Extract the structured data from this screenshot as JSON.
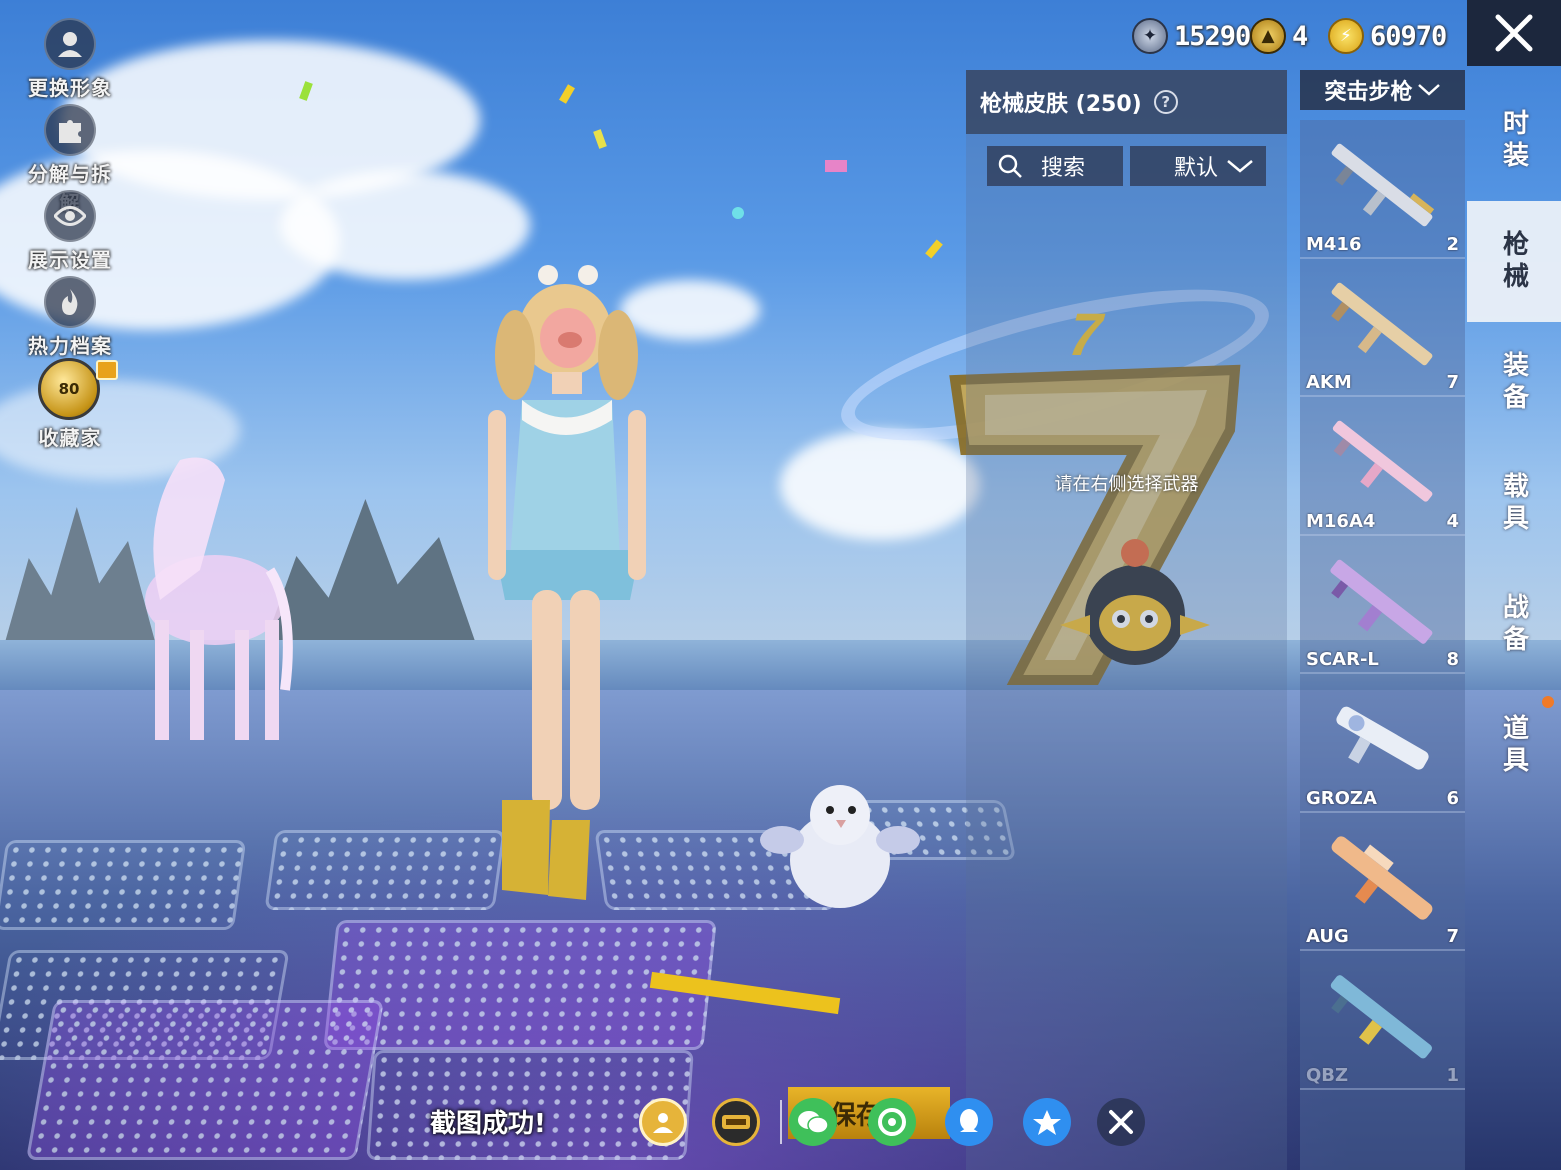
{
  "left_menu": [
    {
      "label": "更换形象",
      "icon": "avatar-icon"
    },
    {
      "label": "分解与拆解",
      "icon": "puzzle-icon"
    },
    {
      "label": "展示设置",
      "icon": "eye-icon"
    },
    {
      "label": "热力档案",
      "icon": "flame-icon"
    },
    {
      "label": "收藏家",
      "icon": "collector-badge-icon",
      "badge_level": "80"
    }
  ],
  "currency": [
    {
      "icon": "silver-coin-icon",
      "value": "15290"
    },
    {
      "icon": "gold-token-icon",
      "value": "4"
    },
    {
      "icon": "lightning-coin-icon",
      "value": "60970"
    }
  ],
  "skin_panel": {
    "title": "枪械皮肤 (250)",
    "search_label": "搜索",
    "sort_label": "默认",
    "hint": "请在右侧选择武器"
  },
  "weapon_category": "突击步枪",
  "weapons": [
    {
      "name": "M416",
      "count": "2"
    },
    {
      "name": "AKM",
      "count": "7"
    },
    {
      "name": "M16A4",
      "count": "4"
    },
    {
      "name": "SCAR-L",
      "count": "8"
    },
    {
      "name": "GROZA",
      "count": "6"
    },
    {
      "name": "AUG",
      "count": "7"
    },
    {
      "name": "QBZ",
      "count": "1"
    }
  ],
  "right_tabs": [
    {
      "label": "时装",
      "active": false
    },
    {
      "label": "枪械",
      "active": true
    },
    {
      "label": "装备",
      "active": false
    },
    {
      "label": "载具",
      "active": false
    },
    {
      "label": "战备",
      "active": false
    },
    {
      "label": "道具",
      "active": false
    }
  ],
  "bottom": {
    "toast": "截图成功!",
    "save_label": "保存图",
    "share_icons": [
      "camp-icon",
      "game-logo-icon",
      "wechat-icon",
      "moments-icon",
      "qq-icon",
      "qzone-icon",
      "close-icon"
    ]
  },
  "colors": {
    "panel_dark": "#374664",
    "accent_gold": "#e8b429",
    "tab_active": "#ebf0f8",
    "notify_dot": "#f07a28"
  }
}
